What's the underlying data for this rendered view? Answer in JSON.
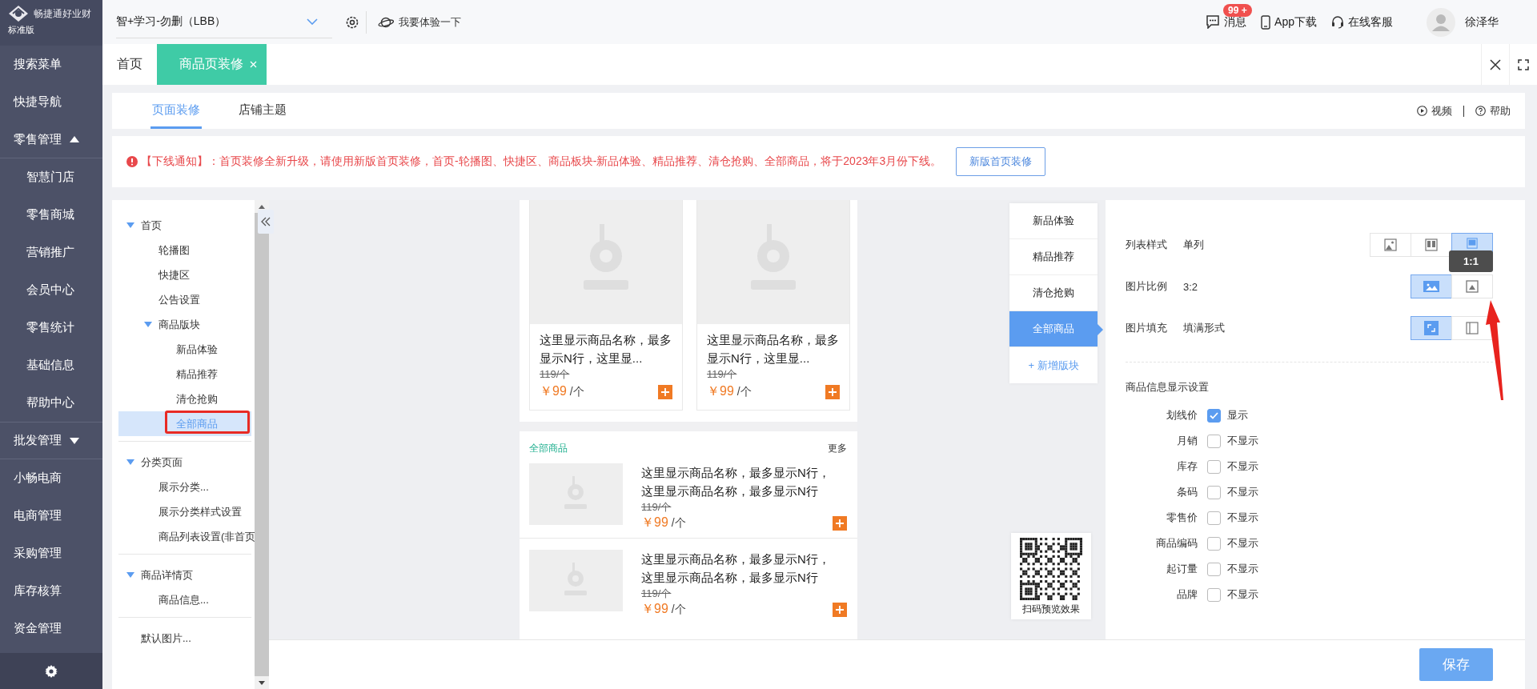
{
  "brand": {
    "name": "畅捷通好业财",
    "edition": "标准版"
  },
  "top_bar": {
    "account": "智+学习-勿删（LBB）",
    "experience": "我要体验一下",
    "messages": {
      "label": "消息",
      "badge": "99 +"
    },
    "app_download": "App下载",
    "support": "在线客服",
    "user": "徐泽华"
  },
  "sidebar": {
    "items": [
      {
        "label": "搜索菜单",
        "kind": "top"
      },
      {
        "label": "快捷导航",
        "kind": "top"
      },
      {
        "label": "零售管理",
        "kind": "group",
        "expanded": true
      },
      {
        "label": "智慧门店",
        "kind": "sub"
      },
      {
        "label": "零售商城",
        "kind": "sub"
      },
      {
        "label": "营销推广",
        "kind": "sub"
      },
      {
        "label": "会员中心",
        "kind": "sub"
      },
      {
        "label": "零售统计",
        "kind": "sub"
      },
      {
        "label": "基础信息",
        "kind": "sub"
      },
      {
        "label": "帮助中心",
        "kind": "sub"
      },
      {
        "label": "批发管理",
        "kind": "group",
        "expanded": false
      },
      {
        "label": "小畅电商",
        "kind": "top"
      },
      {
        "label": "电商管理",
        "kind": "top"
      },
      {
        "label": "采购管理",
        "kind": "top"
      },
      {
        "label": "库存核算",
        "kind": "top"
      },
      {
        "label": "资金管理",
        "kind": "top"
      }
    ]
  },
  "tabs": [
    {
      "label": "首页",
      "selected": false,
      "closable": false
    },
    {
      "label": "商品页装修",
      "selected": true,
      "closable": true
    }
  ],
  "page_tabs": [
    {
      "label": "页面装修",
      "selected": true
    },
    {
      "label": "店铺主题",
      "selected": false
    }
  ],
  "help_links": [
    {
      "label": "视频",
      "kind": "video"
    },
    {
      "label": "帮助",
      "kind": "help"
    }
  ],
  "notice": {
    "title": "【下线通知】：",
    "text": "首页装修全新升级，请使用新版首页装修，首页-轮播图、快捷区、商品板块-新品体验、精品推荐、清仓抢购、全部商品，将于2023年3月份下线。",
    "button": "新版首页装修"
  },
  "tree": [
    {
      "label": "首页",
      "expanded": true,
      "selected": false,
      "children": [
        {
          "label": "轮播图",
          "selected": false
        },
        {
          "label": "快捷区",
          "selected": false
        },
        {
          "label": "公告设置",
          "selected": false
        },
        {
          "label": "商品版块",
          "expanded": true,
          "selected": false,
          "children": [
            {
              "label": "新品体验",
              "selected": false
            },
            {
              "label": "精品推荐",
              "selected": false
            },
            {
              "label": "清仓抢购",
              "selected": false
            },
            {
              "label": "全部商品",
              "selected": true,
              "highlighted": true
            }
          ]
        }
      ]
    },
    {
      "label": "分类页面",
      "expanded": true,
      "selected": false,
      "children": [
        {
          "label": "展示分类...",
          "selected": false
        },
        {
          "label": "展示分类样式设置",
          "selected": false
        },
        {
          "label": "商品列表设置(非首页",
          "selected": false
        }
      ]
    },
    {
      "label": "商品详情页",
      "expanded": true,
      "selected": false,
      "children": [
        {
          "label": "商品信息...",
          "selected": false
        }
      ]
    },
    {
      "label": "默认图片...",
      "selected": false
    }
  ],
  "preview": {
    "grid_products": [
      {
        "name": "这里显示商品名称，最多显示N行，这里显...",
        "old_price": "119/个",
        "price": "￥99",
        "unit": "/个"
      },
      {
        "name": "这里显示商品名称，最多显示N行，这里显...",
        "old_price": "119/个",
        "price": "￥99",
        "unit": "/个"
      }
    ],
    "list_section": {
      "title": "全部商品",
      "more": "更多",
      "products": [
        {
          "name": "这里显示商品名称，最多显示N行，这里显示商品名称，最多显示N行",
          "old_price": "119/个",
          "price": "￥99",
          "unit": "/个"
        },
        {
          "name": "这里显示商品名称，最多显示N行，这里显示商品名称，最多显示N行",
          "old_price": "119/个",
          "price": "￥99",
          "unit": "/个"
        }
      ]
    }
  },
  "section_tabs": [
    {
      "label": "新品体验",
      "selected": false
    },
    {
      "label": "精品推荐",
      "selected": false
    },
    {
      "label": "清仓抢购",
      "selected": false
    },
    {
      "label": "全部商品",
      "selected": true
    }
  ],
  "add_section": "+ 新增版块",
  "qr_caption": "扫码预览效果",
  "settings": {
    "rows": [
      {
        "label": "列表样式",
        "value": "单列",
        "options": [
          {
            "kind": "picture",
            "selected": false
          },
          {
            "kind": "double",
            "selected": false
          },
          {
            "kind": "single",
            "selected": true
          }
        ]
      },
      {
        "label": "图片比例",
        "value": "3:2",
        "options": [
          {
            "kind": "wide",
            "selected": true
          },
          {
            "kind": "square",
            "selected": false,
            "tooltip": "1:1"
          }
        ]
      },
      {
        "label": "图片填充",
        "value": "填满形式",
        "options": [
          {
            "kind": "fill",
            "selected": true
          },
          {
            "kind": "fit",
            "selected": false
          }
        ]
      }
    ],
    "display_title": "商品信息显示设置",
    "fields": [
      {
        "label": "划线价",
        "checked": true,
        "state": "显示"
      },
      {
        "label": "月销",
        "checked": false,
        "state": "不显示"
      },
      {
        "label": "库存",
        "checked": false,
        "state": "不显示"
      },
      {
        "label": "条码",
        "checked": false,
        "state": "不显示"
      },
      {
        "label": "零售价",
        "checked": false,
        "state": "不显示"
      },
      {
        "label": "商品编码",
        "checked": false,
        "state": "不显示"
      },
      {
        "label": "起订量",
        "checked": false,
        "state": "不显示"
      },
      {
        "label": "品牌",
        "checked": false,
        "state": "不显示"
      }
    ]
  },
  "save": "保存"
}
